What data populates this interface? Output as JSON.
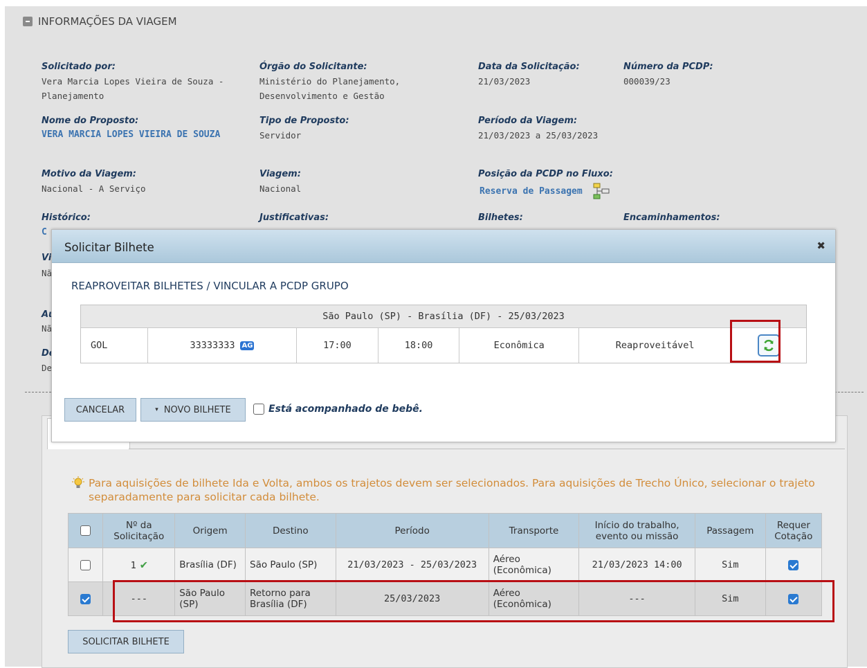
{
  "section": {
    "title": "INFORMAÇÕES DA VIAGEM"
  },
  "fields": {
    "solicitado_por": {
      "label": "Solicitado por:",
      "value": "Vera Marcia Lopes Vieira de Souza - Planejamento"
    },
    "orgao": {
      "label": "Órgão do Solicitante:",
      "value": "Ministério do Planejamento, Desenvolvimento e Gestão"
    },
    "data_solicitacao": {
      "label": "Data da Solicitação:",
      "value": "21/03/2023"
    },
    "numero_pcdp": {
      "label": "Número da PCDP:",
      "value": "000039/23"
    },
    "nome_proposto": {
      "label": "Nome do Proposto:",
      "value": "VERA MARCIA LOPES VIEIRA DE SOUZA"
    },
    "tipo_proposto": {
      "label": "Tipo de Proposto:",
      "value": "Servidor"
    },
    "periodo": {
      "label": "Período da Viagem:",
      "value": "21/03/2023 a 25/03/2023"
    },
    "motivo": {
      "label": "Motivo da Viagem:",
      "value": "Nacional - A Serviço"
    },
    "viagem": {
      "label": "Viagem:",
      "value": "Nacional"
    },
    "posicao": {
      "label": "Posição da PCDP no Fluxo:",
      "value": "Reserva de Passagem"
    },
    "historico": {
      "label": "Histórico:",
      "value": "C"
    },
    "justificativas": {
      "label": "Justificativas:"
    },
    "bilhetes": {
      "label": "Bilhetes:"
    },
    "encaminhamentos": {
      "label": "Encaminhamentos:"
    },
    "partial": {
      "vi": "Vi",
      "na1": "Nã",
      "au": "Au",
      "na2": "Nã",
      "de_lbl": "De",
      "de_val": "De"
    }
  },
  "modal": {
    "title": "Solicitar Bilhete",
    "close": "✖",
    "subtitle": "REAPROVEITAR BILHETES / VINCULAR A PCDP GRUPO",
    "route": "São Paulo (SP) - Brasília (DF) - 25/03/2023",
    "ticket": {
      "airline": "GOL",
      "number": "33333333",
      "badge": "AG",
      "depart": "17:00",
      "arrive": "18:00",
      "class": "Econômica",
      "status": "Reaproveitável"
    },
    "cancel_label": "CANCELAR",
    "new_ticket_label": "NOVO BILHETE",
    "new_ticket_arrow": "▾",
    "baby_label": "Está acompanhado de bebê."
  },
  "tip": "Para aquisições de bilhete Ida e Volta, ambos os trajetos devem ser selecionados. Para aquisições de Trecho Único, selecionar o trajeto separadamente para solicitar cada bilhete.",
  "table": {
    "headers": [
      "Nº da Solicitação",
      "Origem",
      "Destino",
      "Período",
      "Transporte",
      "Início do trabalho, evento ou missão",
      "Passagem",
      "Requer Cotação"
    ],
    "rows": [
      {
        "num": "1",
        "origem": "Brasília (DF)",
        "destino": "São Paulo (SP)",
        "periodo": "21/03/2023 - 25/03/2023",
        "transporte": "Aéreo (Econômica)",
        "inicio": "21/03/2023 14:00",
        "passagem": "Sim"
      },
      {
        "num": "---",
        "origem": "São Paulo (SP)",
        "destino": "Retorno para Brasília (DF)",
        "periodo": "25/03/2023",
        "transporte": "Aéreo (Econômica)",
        "inicio": "---",
        "passagem": "Sim"
      }
    ]
  },
  "solicitar_label": "SOLICITAR BILHETE",
  "colors": {
    "accent": "#3b73b0",
    "highlight": "#b80f14",
    "header": "#b8cfdf",
    "tip": "#d28d3b"
  }
}
